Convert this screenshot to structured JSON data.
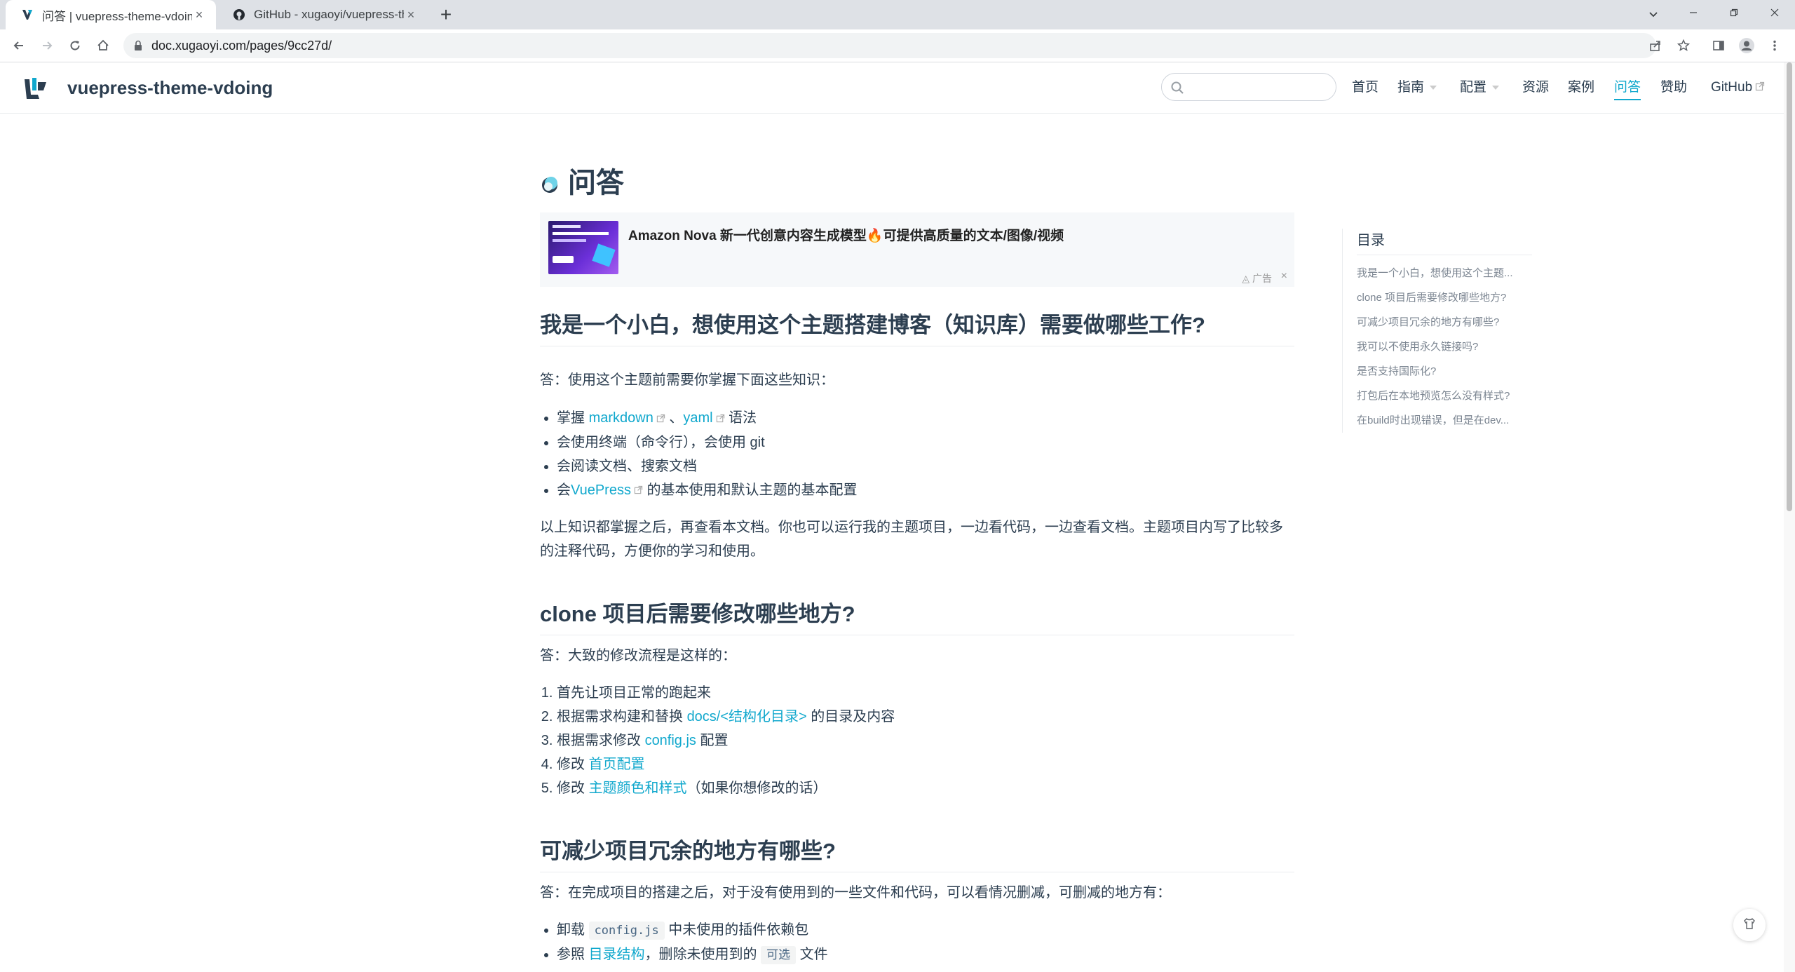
{
  "browser": {
    "tabs": [
      {
        "title": "问答 | vuepress-theme-vdoing",
        "active": true
      },
      {
        "title": "GitHub - xugaoyi/vuepress-the",
        "active": false
      }
    ],
    "url": "doc.xugaoyi.com/pages/9cc27d/"
  },
  "site": {
    "title": "vuepress-theme-vdoing",
    "search_placeholder": "",
    "nav": [
      {
        "label": "首页"
      },
      {
        "label": "指南"
      },
      {
        "label": "配置"
      },
      {
        "label": "资源"
      },
      {
        "label": "案例"
      },
      {
        "label": "问答"
      },
      {
        "label": "赞助"
      },
      {
        "label": "GitHub"
      }
    ]
  },
  "page": {
    "title": "问答",
    "ad": {
      "title": "Amazon Nova 新一代创意内容生成模型🔥可提供高质量的文本/图像/视频",
      "label": "广告",
      "close": "×"
    },
    "section1": {
      "heading": "我是一个小白，想使用这个主题搭建博客（知识库）需要做哪些工作?",
      "intro": "答：使用这个主题前需要你掌握下面这些知识：",
      "items": {
        "i1_pre": "掌握 ",
        "i1_link1": "markdown",
        "i1_mid": " 、",
        "i1_link2": "yaml",
        "i1_post": " 语法",
        "i2": "会使用终端（命令行），会使用 git",
        "i3": "会阅读文档、搜索文档",
        "i4_pre": "会",
        "i4_link": "VuePress",
        "i4_post": " 的基本使用和默认主题的基本配置"
      },
      "outro": "以上知识都掌握之后，再查看本文档。你也可以运行我的主题项目，一边看代码，一边查看文档。主题项目内写了比较多的注释代码，方便你的学习和使用。"
    },
    "section2": {
      "heading": "clone 项目后需要修改哪些地方?",
      "intro": "答：大致的修改流程是这样的：",
      "items": {
        "i1": "首先让项目正常的跑起来",
        "i2_pre": "根据需求构建和替换 ",
        "i2_link": "docs/<结构化目录>",
        "i2_post": " 的目录及内容",
        "i3_pre": "根据需求修改 ",
        "i3_link": "config.js",
        "i3_post": " 配置",
        "i4_pre": "修改 ",
        "i4_link": "首页配置",
        "i5_pre": "修改 ",
        "i5_link": "主题颜色和样式",
        "i5_post": "（如果你想修改的话）"
      }
    },
    "section3": {
      "heading": "可减少项目冗余的地方有哪些?",
      "intro": "答：在完成项目的搭建之后，对于没有使用到的一些文件和代码，可以看情况删减，可删减的地方有：",
      "items": {
        "i1_pre": "卸载 ",
        "i1_code": "config.js",
        "i1_post": " 中未使用的插件依赖包",
        "i2_pre": "参照 ",
        "i2_link": "目录结构",
        "i2_mid": "，删除未使用到的 ",
        "i2_code": "可选",
        "i2_post": " 文件"
      }
    }
  },
  "toc": {
    "title": "目录",
    "items": [
      "我是一个小白，想使用这个主题...",
      "clone 项目后需要修改哪些地方?",
      "可减少项目冗余的地方有哪些?",
      "我可以不使用永久链接吗?",
      "是否支持国际化?",
      "打包后在本地预览怎么没有样式?",
      "在build时出现错误，但是在dev..."
    ]
  },
  "colors": {
    "accent": "#11a8cd",
    "text": "#2c3e50"
  }
}
